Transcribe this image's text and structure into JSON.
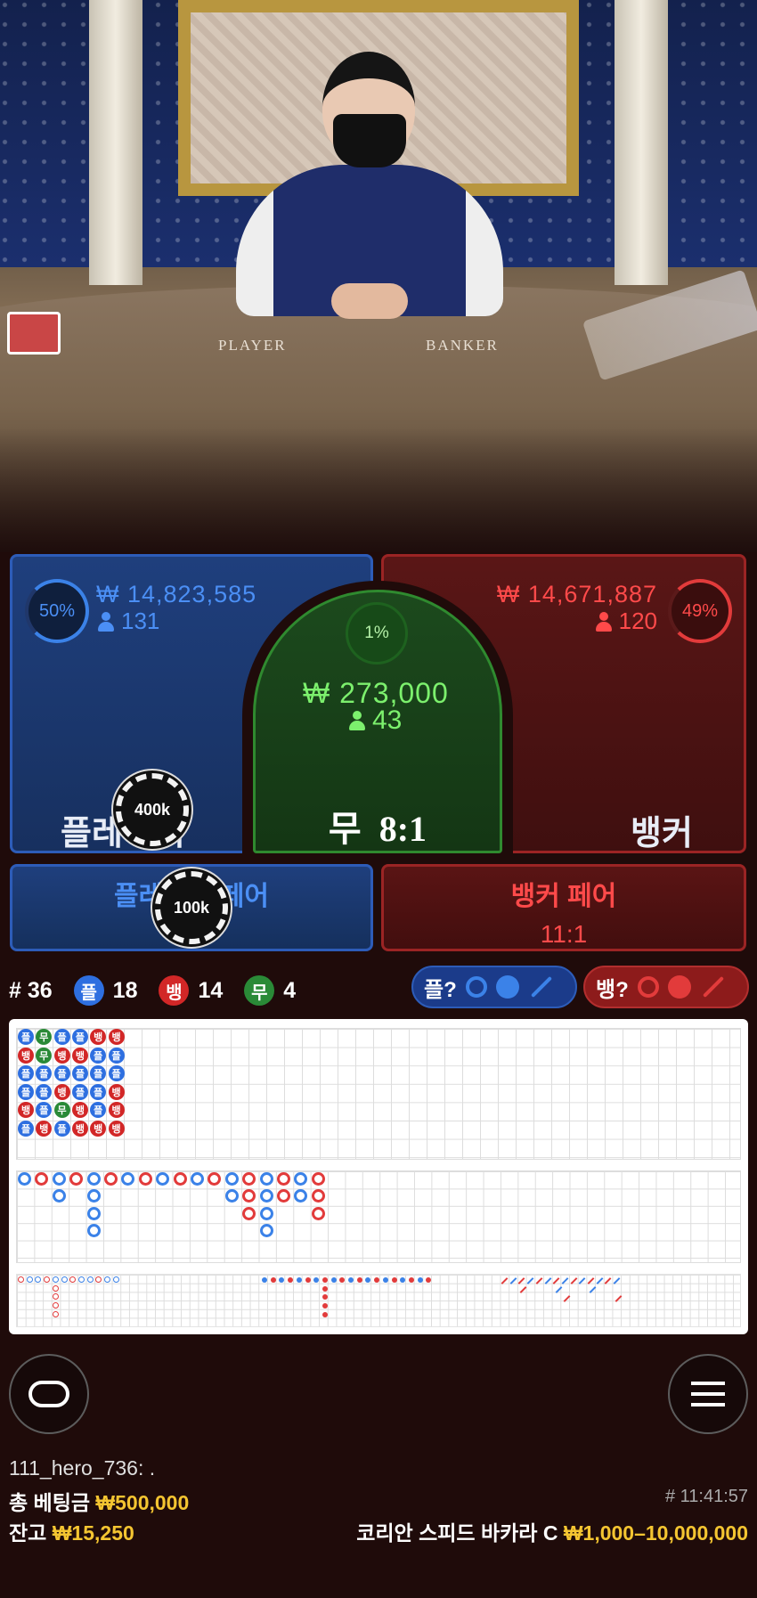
{
  "table": {
    "felt_player": "PLAYER",
    "felt_banker": "BANKER"
  },
  "player": {
    "percent": "50%",
    "amount": "₩ 14,823,585",
    "players": "131",
    "label": "플레이어",
    "chip": "400k",
    "color": "#4b8ff5"
  },
  "banker": {
    "percent": "49%",
    "amount": "₩ 14,671,887",
    "players": "120",
    "label": "뱅커",
    "color": "#ff4a4a"
  },
  "tie": {
    "percent": "1%",
    "amount": "₩ 273,000",
    "players": "43",
    "label": "무",
    "odds": "8:1",
    "color": "#7cf06d"
  },
  "player_pair": {
    "label": "플레이어 페어",
    "chip": "100k"
  },
  "banker_pair": {
    "label": "뱅커 페어",
    "odds": "11:1"
  },
  "stats": {
    "round": "# 36",
    "player_badge": "플",
    "player_count": "18",
    "banker_badge": "뱅",
    "banker_count": "14",
    "tie_badge": "무",
    "tie_count": "4"
  },
  "ask": {
    "player_label": "플?",
    "banker_label": "뱅?"
  },
  "bead_road": [
    [
      "플",
      "뱅",
      "플",
      "플",
      "뱅",
      "플"
    ],
    [
      "무",
      "무",
      "플",
      "플",
      "플",
      "뱅"
    ],
    [
      "플",
      "뱅",
      "플",
      "뱅",
      "무",
      "플"
    ],
    [
      "플",
      "뱅",
      "플",
      "플",
      "뱅",
      "뱅"
    ],
    [
      "뱅",
      "플",
      "플",
      "플",
      "플",
      "뱅"
    ],
    [
      "뱅",
      "플",
      "플",
      "뱅",
      "뱅",
      "뱅"
    ]
  ],
  "chat": {
    "message": "111_hero_736: ."
  },
  "footer": {
    "total_bet_label": "총 베팅금",
    "total_bet_value": "₩500,000",
    "balance_label": "잔고",
    "balance_value": "₩15,250",
    "time": "# 11:41:57",
    "table_name": "코리안 스피드 바카라 C",
    "limits": "₩1,000–10,000,000"
  }
}
